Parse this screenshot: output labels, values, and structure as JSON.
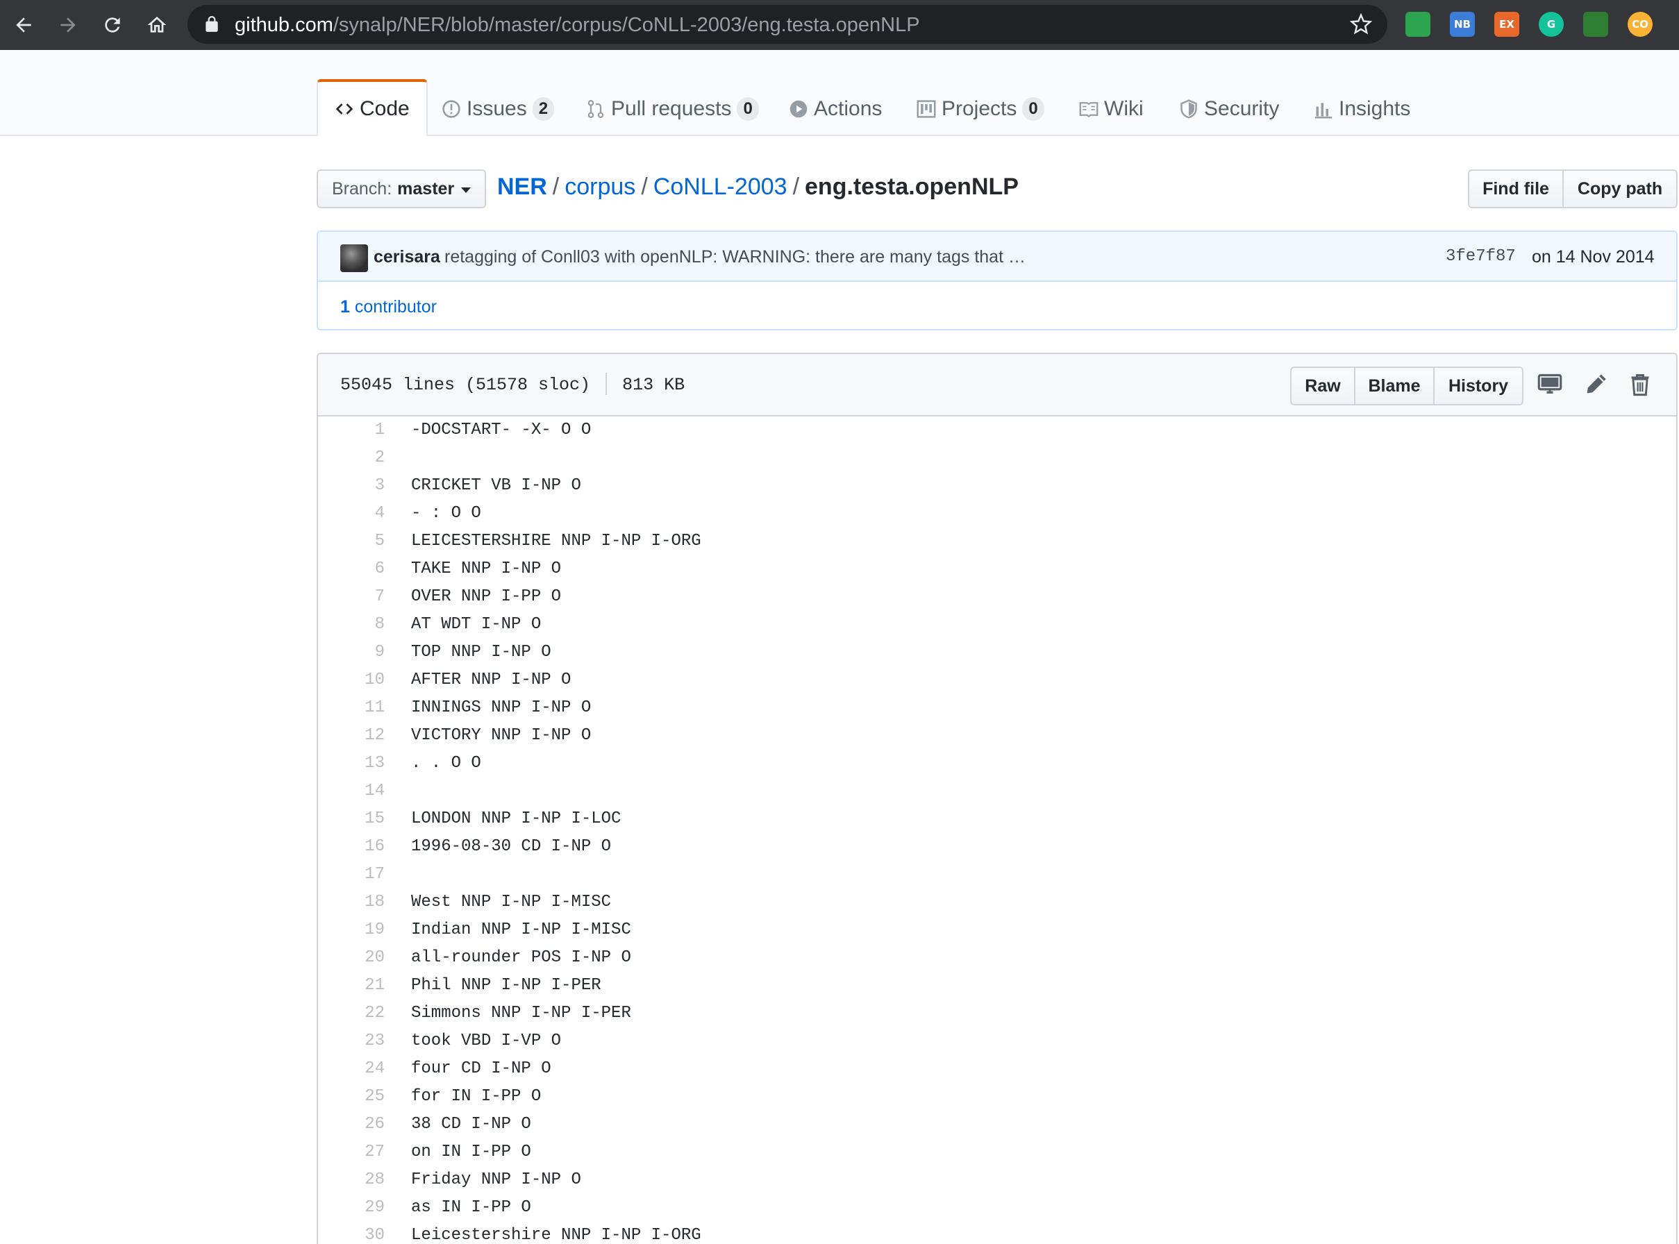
{
  "browser": {
    "url_host": "github.com",
    "url_path": "/synalp/NER/blob/master/corpus/CoNLL-2003/eng.testa.openNLP",
    "extensions": [
      {
        "name": "tab-ext",
        "label": "",
        "color": "#2da44e"
      },
      {
        "name": "nb-ext",
        "label": "NB",
        "color": "#3b7dd8"
      },
      {
        "name": "ex-ext",
        "label": "EX",
        "color": "#e8672a"
      },
      {
        "name": "grammarly-ext",
        "label": "G",
        "color": "#15c39a"
      },
      {
        "name": "pen-ext",
        "label": "",
        "color": "#2e7d32"
      },
      {
        "name": "co-ext",
        "label": "CO",
        "color": "#f9b233"
      }
    ]
  },
  "reponav": {
    "code": "Code",
    "issues": "Issues",
    "issues_count": "2",
    "pulls": "Pull requests",
    "pulls_count": "0",
    "actions": "Actions",
    "projects": "Projects",
    "projects_count": "0",
    "wiki": "Wiki",
    "security": "Security",
    "insights": "Insights"
  },
  "filenav": {
    "branch_label": "Branch:",
    "branch_name": "master",
    "breadcrumb": [
      "NER",
      "corpus",
      "CoNLL-2003"
    ],
    "file_name": "eng.testa.openNLP",
    "separator": "/",
    "find_file": "Find file",
    "copy_path": "Copy path"
  },
  "commit": {
    "author": "cerisara",
    "message": "retagging of Conll03 with openNLP: WARNING: there are many tags that …",
    "sha": "3fe7f87",
    "date": "on 14 Nov 2014",
    "contributors_count": "1",
    "contributors_label": "contributor"
  },
  "file": {
    "lines_info": "55045 lines (51578 sloc)",
    "size": "813 KB",
    "raw": "Raw",
    "blame": "Blame",
    "history": "History",
    "lines": [
      "-DOCSTART- -X- O O",
      "",
      "CRICKET VB I-NP O",
      "- : O O",
      "LEICESTERSHIRE NNP I-NP I-ORG",
      "TAKE NNP I-NP O",
      "OVER NNP I-PP O",
      "AT WDT I-NP O",
      "TOP NNP I-NP O",
      "AFTER NNP I-NP O",
      "INNINGS NNP I-NP O",
      "VICTORY NNP I-NP O",
      ". . O O",
      "",
      "LONDON NNP I-NP I-LOC",
      "1996-08-30 CD I-NP O",
      "",
      "West NNP I-NP I-MISC",
      "Indian NNP I-NP I-MISC",
      "all-rounder POS I-NP O",
      "Phil NNP I-NP I-PER",
      "Simmons NNP I-NP I-PER",
      "took VBD I-VP O",
      "four CD I-NP O",
      "for IN I-PP O",
      "38 CD I-NP O",
      "on IN I-PP O",
      "Friday NNP I-NP O",
      "as IN I-PP O",
      "Leicestershire NNP I-NP I-ORG"
    ]
  }
}
